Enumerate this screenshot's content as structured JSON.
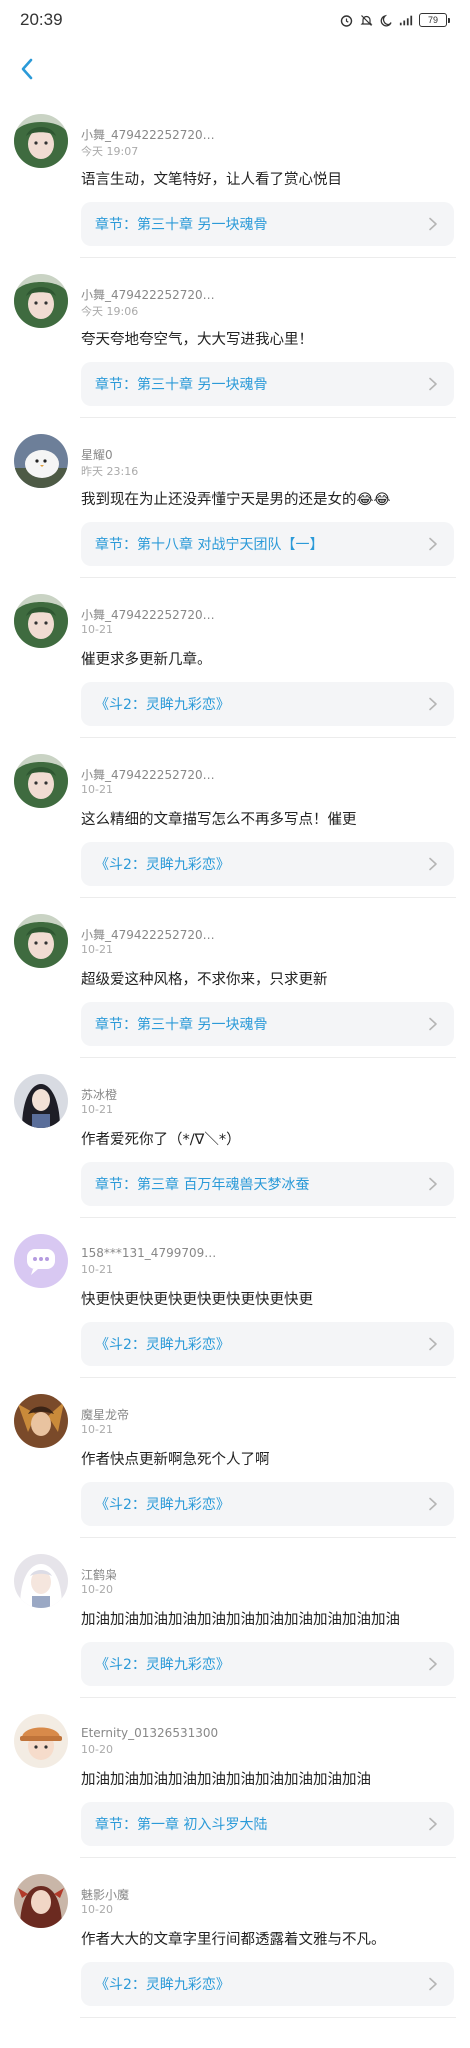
{
  "status": {
    "time": "20:39",
    "battery": "79",
    "icons": [
      "alarm-icon",
      "mute-icon",
      "moon-icon",
      "signal-icon",
      "battery-icon"
    ]
  },
  "nav": {
    "back_icon": "back-chevron-icon"
  },
  "colors": {
    "accent": "#2b9ad8",
    "card_bg": "#f4f5f7"
  },
  "comments": [
    {
      "user": "小舞_479422252720…",
      "time": "今天 19:07",
      "text": "语言生动，文笔特好，让人看了赏心悦目",
      "chapter": "章节：第三十章 另一块魂骨",
      "avatar": "green-hair"
    },
    {
      "user": "小舞_479422252720…",
      "time": "今天 19:06",
      "text": "夸天夸地夸空气，大大写进我心里！",
      "chapter": "章节：第三十章 另一块魂骨",
      "avatar": "green-hair"
    },
    {
      "user": "星耀0",
      "time": "昨天 23:16",
      "text": "我到现在为止还没弄懂宁天是男的还是女的😂😂",
      "chapter": "章节：第十八章 对战宁天团队【一】",
      "avatar": "white-bird"
    },
    {
      "user": "小舞_479422252720…",
      "time": "10-21",
      "text": "催更求多更新几章。",
      "chapter": "《斗2：灵眸九彩恋》",
      "avatar": "green-hair"
    },
    {
      "user": "小舞_479422252720…",
      "time": "10-21",
      "text": "这么精细的文章描写怎么不再多写点！催更",
      "chapter": "《斗2：灵眸九彩恋》",
      "avatar": "green-hair"
    },
    {
      "user": "小舞_479422252720…",
      "time": "10-21",
      "text": "超级爱这种风格，不求你来，只求更新",
      "chapter": "章节：第三十章 另一块魂骨",
      "avatar": "green-hair"
    },
    {
      "user": "苏冰橙",
      "time": "10-21",
      "text": "作者爱死你了（*/∇＼*）",
      "chapter": "章节：第三章 百万年魂兽天梦冰蚕",
      "avatar": "dark-girl"
    },
    {
      "user": "158***131_4799709…",
      "time": "10-21",
      "text": "快更快更快更快更快更快更快更快更",
      "chapter": "《斗2：灵眸九彩恋》",
      "avatar": "purple-chat"
    },
    {
      "user": "魔星龙帝",
      "time": "10-21",
      "text": "作者快点更新啊急死个人了啊",
      "chapter": "《斗2：灵眸九彩恋》",
      "avatar": "brown-warrior"
    },
    {
      "user": "江鹤枭",
      "time": "10-20",
      "text": "加油加油加油加油加油加油加油加油加油加油加油",
      "chapter": "《斗2：灵眸九彩恋》",
      "avatar": "white-hair"
    },
    {
      "user": "Eternity_01326531300",
      "time": "10-20",
      "text": "加油加油加油加油加油加油加油加油加油加油",
      "chapter": "章节：第一章 初入斗罗大陆",
      "avatar": "orange-hat"
    },
    {
      "user": "魅影小魔",
      "time": "10-20",
      "text": "作者大大的文章字里行间都透露着文雅与不凡。",
      "chapter": "《斗2：灵眸九彩恋》",
      "avatar": "red-girl"
    }
  ]
}
